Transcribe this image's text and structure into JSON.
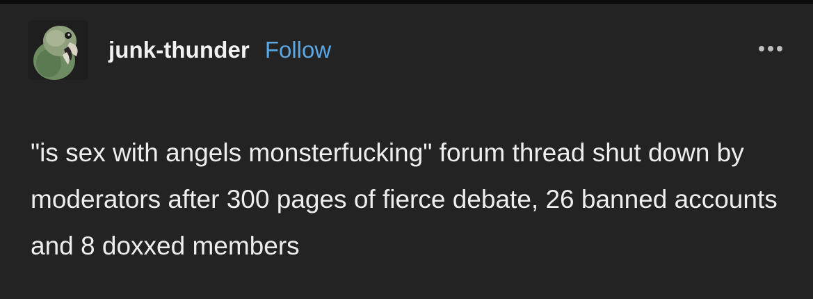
{
  "post": {
    "author": {
      "username": "junk-thunder",
      "follow_label": "Follow",
      "avatar_icon": "parrot-avatar"
    },
    "menu_icon": "more-options-icon",
    "text": "\"is sex with angels monsterfucking\" forum thread shut down by moderators after 300 pages of fierce debate, 26 banned accounts and 8 doxxed members"
  },
  "colors": {
    "background": "#232323",
    "text": "#eeeeee",
    "follow": "#5aa8e6"
  }
}
